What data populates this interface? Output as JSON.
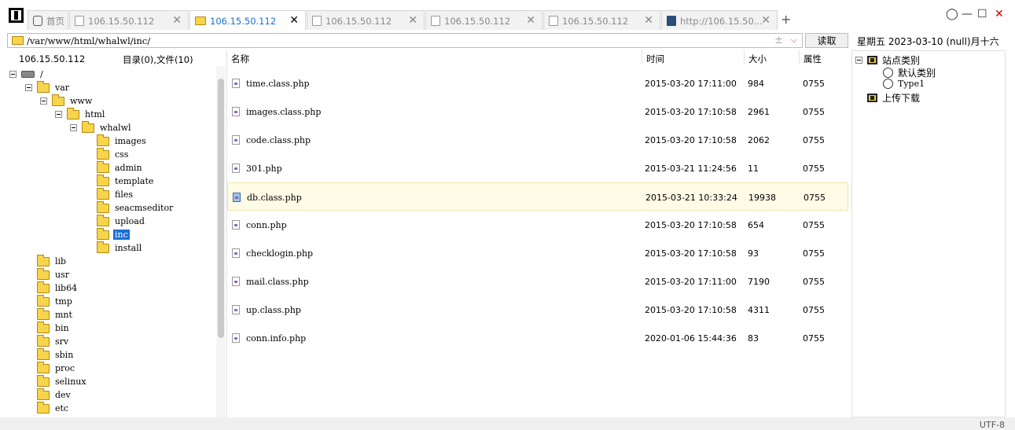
{
  "tabs": [
    {
      "label": "首页",
      "icon": "home-icon",
      "active": false
    },
    {
      "label": "106.15.50.112",
      "icon": "document-icon",
      "active": false
    },
    {
      "label": "106.15.50.112",
      "icon": "folder-icon",
      "active": true
    },
    {
      "label": "106.15.50.112",
      "icon": "document-icon",
      "active": false
    },
    {
      "label": "106.15.50.112",
      "icon": "document-icon",
      "active": false
    },
    {
      "label": "106.15.50.112",
      "icon": "document-icon",
      "active": false
    },
    {
      "label": "http://106.15.50...",
      "icon": "info-icon",
      "active": false
    }
  ],
  "tab_add_label": "+",
  "tab_close_label": "✕",
  "window": {
    "restore": "◯",
    "minimize": "—",
    "maximize": "☐",
    "close": "✕"
  },
  "address": {
    "path": "/var/www/html/whalwl/inc/",
    "plus": "±",
    "chevron": "⌵",
    "read_button": "读取",
    "date": "星期五 2023-03-10 (null)月十六"
  },
  "left_panel": {
    "host": "106.15.50.112",
    "dir_count": "目录(0),文件(10)",
    "tree": [
      {
        "label": "/",
        "selected": false
      },
      {
        "label": "var",
        "selected": false
      },
      {
        "label": "www",
        "selected": false
      },
      {
        "label": "html",
        "selected": false
      },
      {
        "label": "whalwl",
        "selected": false
      },
      {
        "label": "images",
        "selected": false
      },
      {
        "label": "css",
        "selected": false
      },
      {
        "label": "admin",
        "selected": false
      },
      {
        "label": "template",
        "selected": false
      },
      {
        "label": "files",
        "selected": false
      },
      {
        "label": "seacmseditor",
        "selected": false
      },
      {
        "label": "upload",
        "selected": false
      },
      {
        "label": "inc",
        "selected": true
      },
      {
        "label": "install",
        "selected": false
      },
      {
        "label": "lib",
        "selected": false
      },
      {
        "label": "usr",
        "selected": false
      },
      {
        "label": "lib64",
        "selected": false
      },
      {
        "label": "tmp",
        "selected": false
      },
      {
        "label": "mnt",
        "selected": false
      },
      {
        "label": "bin",
        "selected": false
      },
      {
        "label": "srv",
        "selected": false
      },
      {
        "label": "sbin",
        "selected": false
      },
      {
        "label": "proc",
        "selected": false
      },
      {
        "label": "selinux",
        "selected": false
      },
      {
        "label": "dev",
        "selected": false
      },
      {
        "label": "etc",
        "selected": false
      }
    ]
  },
  "file_list": {
    "columns": {
      "name": "名称",
      "time": "时间",
      "size": "大小",
      "attr": "属性"
    },
    "rows": [
      {
        "name": "time.class.php",
        "time": "2015-03-20 17:11:00",
        "size": "984",
        "attr": "0755",
        "highlighted": false
      },
      {
        "name": "images.class.php",
        "time": "2015-03-20 17:10:58",
        "size": "2961",
        "attr": "0755",
        "highlighted": false
      },
      {
        "name": "code.class.php",
        "time": "2015-03-20 17:10:58",
        "size": "2062",
        "attr": "0755",
        "highlighted": false
      },
      {
        "name": "301.php",
        "time": "2015-03-21 11:24:56",
        "size": "11",
        "attr": "0755",
        "highlighted": false
      },
      {
        "name": "db.class.php",
        "time": "2015-03-21 10:33:24",
        "size": "19938",
        "attr": "0755",
        "highlighted": true
      },
      {
        "name": "conn.php",
        "time": "2015-03-20 17:10:58",
        "size": "654",
        "attr": "0755",
        "highlighted": false
      },
      {
        "name": "checklogin.php",
        "time": "2015-03-20 17:10:58",
        "size": "93",
        "attr": "0755",
        "highlighted": false
      },
      {
        "name": "mail.class.php",
        "time": "2015-03-20 17:11:00",
        "size": "7190",
        "attr": "0755",
        "highlighted": false
      },
      {
        "name": "up.class.php",
        "time": "2015-03-20 17:10:58",
        "size": "4311",
        "attr": "0755",
        "highlighted": false
      },
      {
        "name": "conn.info.php",
        "time": "2020-01-06 15:44:36",
        "size": "83",
        "attr": "0755",
        "highlighted": false
      }
    ]
  },
  "right_panel": {
    "site_category": "站点类别",
    "default_category": "默认类别",
    "type1": "Type1",
    "upload_download": "上传下载"
  },
  "status": {
    "encoding": "UTF-8"
  }
}
